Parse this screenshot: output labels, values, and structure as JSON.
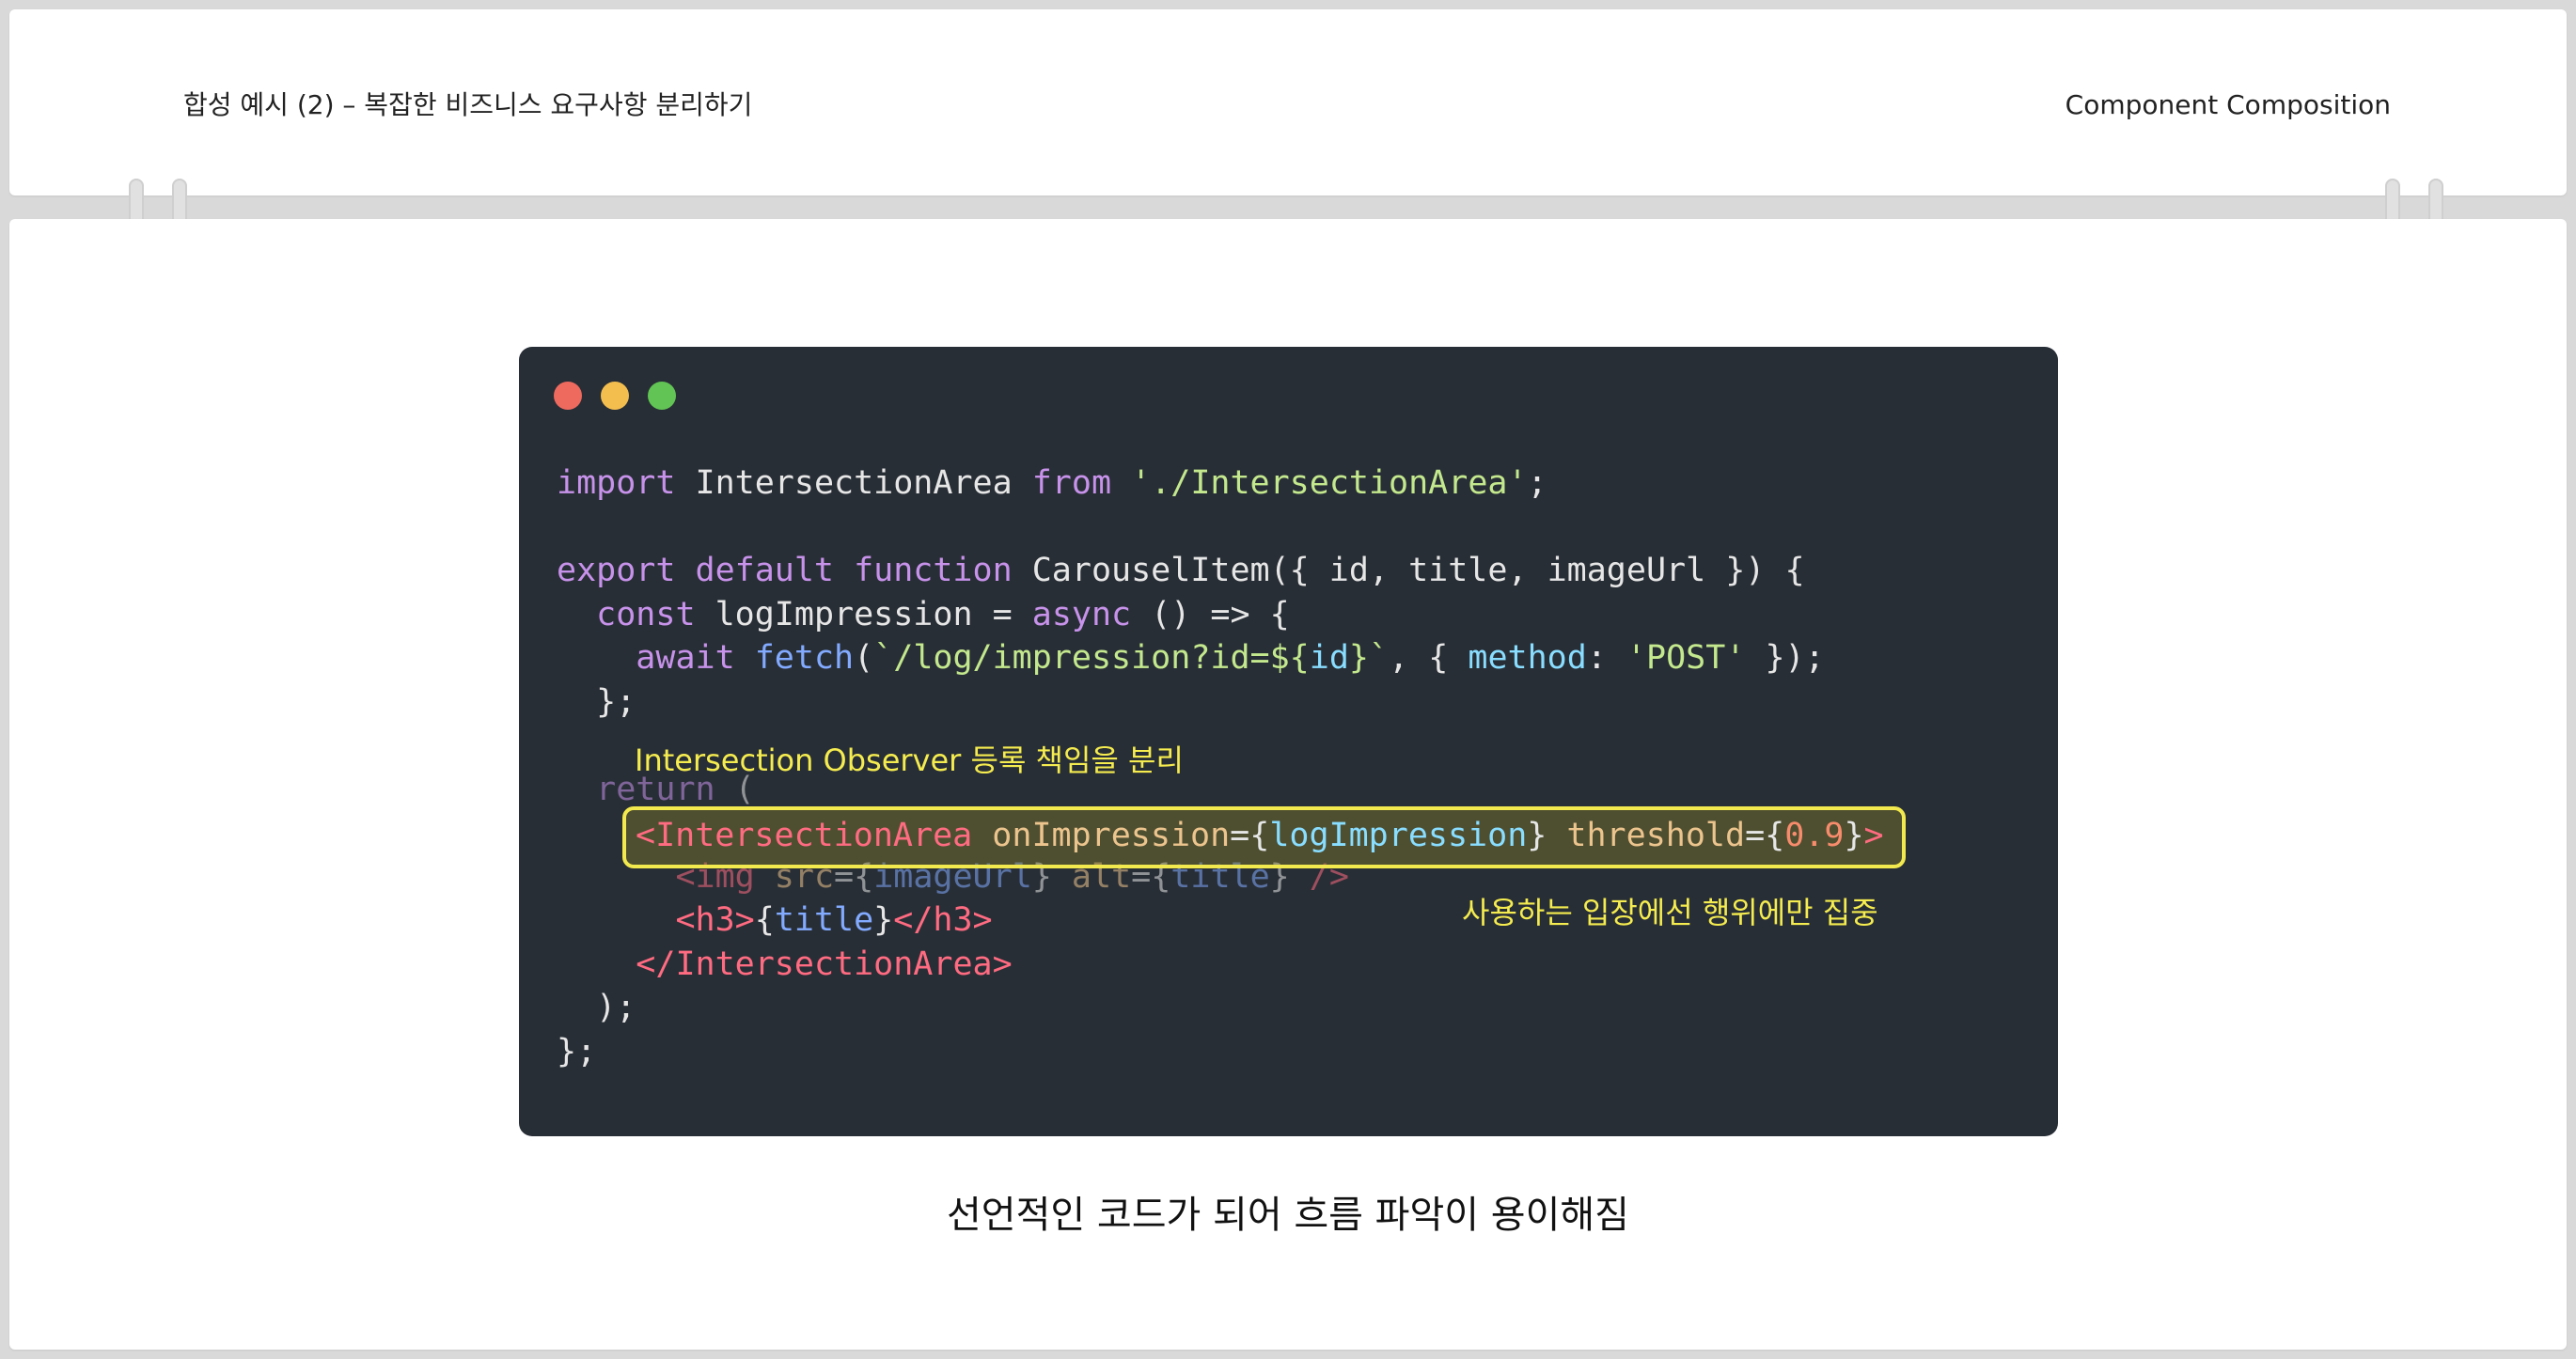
{
  "header": {
    "left_title": "합성 예시 (2) – 복잡한 비즈니스 요구사항 분리하기",
    "right_title": "Component Composition"
  },
  "code": {
    "line1": {
      "kw": "import",
      "name": " IntersectionArea ",
      "kw2": "from",
      "str": " './IntersectionArea'",
      "end": ";"
    },
    "line3": {
      "kw": "export default function",
      "rest": " CarouselItem({ id, title, imageUrl }) {"
    },
    "line4": {
      "kw": "const",
      "mid": " logImpression = ",
      "kw2": "async",
      "rest": " () => {"
    },
    "line5": {
      "kw": "await",
      "fn": "fetch",
      "open": "(",
      "str1": "`/log/impression?id=${",
      "var": "id",
      "str2": "}`",
      "mid": ", { ",
      "prop": "method",
      "colon": ": ",
      "str3": "'POST'",
      "end": " });"
    },
    "line6": "};",
    "line7": {
      "kw": "return",
      "rest": " ("
    },
    "line8": {
      "tag_open": "<IntersectionArea",
      "attr1": " onImpression",
      "eq1": "={",
      "val1": "logImpression",
      "close1": "}",
      "attr2": " threshold",
      "eq2": "={",
      "val2": "0.9",
      "close2": "}",
      "tag_close": ">"
    },
    "line9": {
      "tag": "<img",
      "attr1": " src",
      "eq1": "={",
      "val1": "imageUrl",
      "close1": "}",
      "attr2": " alt",
      "eq2": "={",
      "val2": "title",
      "close2": "}",
      "end": " />"
    },
    "line10": {
      "tag1": "<h3>",
      "open": "{",
      "val": "title",
      "close": "}",
      "tag2": "</h3>"
    },
    "line11": "</IntersectionArea>",
    "line12": ");",
    "line13": "};"
  },
  "annotations": {
    "top": "Intersection Observer 등록 책임을 분리",
    "right": "사용하는 입장에선 행위에만 집중"
  },
  "caption": "선언적인 코드가 되어 흐름 파악이 용이해짐",
  "colors": {
    "code_bg": "#282e36",
    "highlight": "#f2e94e",
    "annotation": "#f5ec4f"
  }
}
